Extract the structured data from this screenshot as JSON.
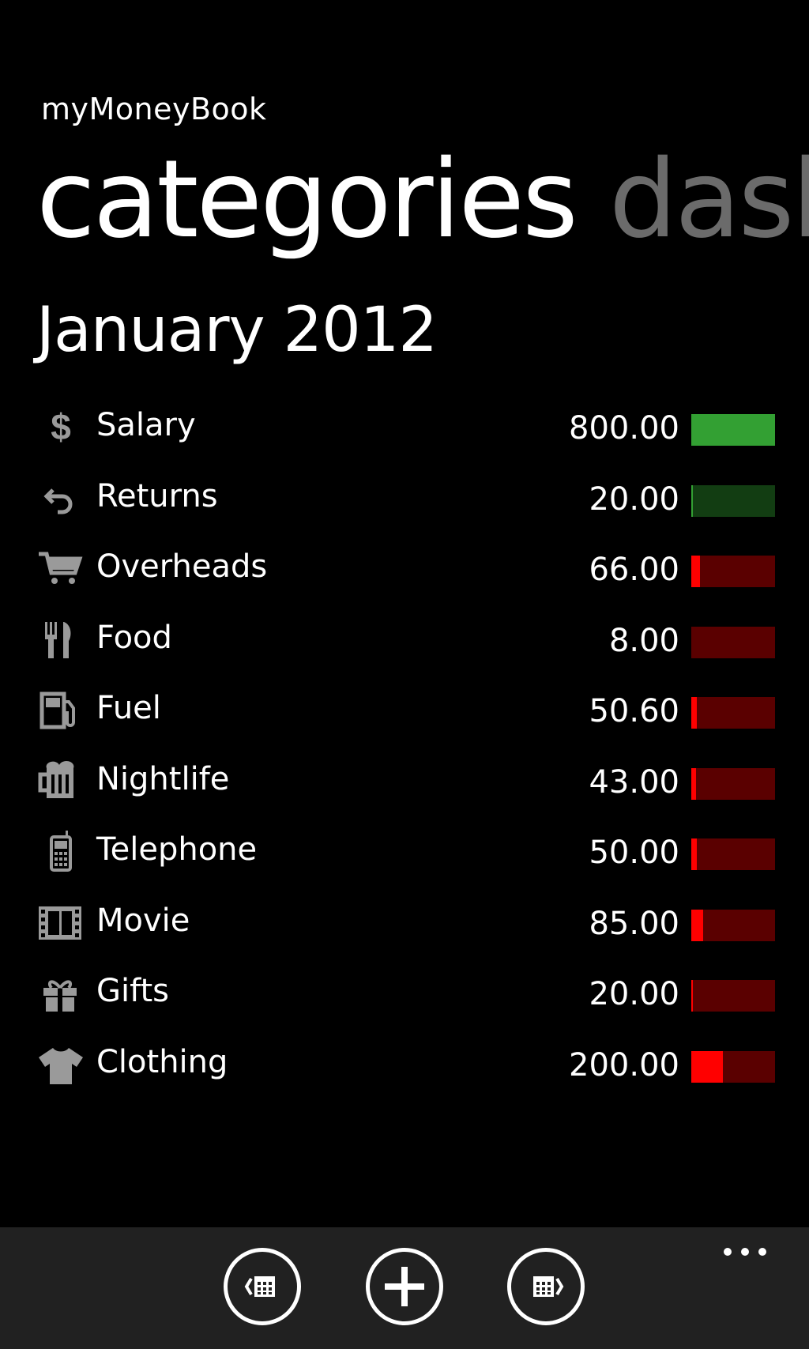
{
  "app": {
    "title": "myMoneyBook"
  },
  "pivot": {
    "items": [
      "categories",
      "dashboard"
    ]
  },
  "period": "January 2012",
  "categories": [
    {
      "name": "Salary",
      "amount": "800.00",
      "icon": "dollar-icon",
      "type": "income",
      "fill": 1.0
    },
    {
      "name": "Returns",
      "amount": "20.00",
      "icon": "return-arrow-icon",
      "type": "income",
      "fill": 0.02
    },
    {
      "name": "Overheads",
      "amount": "66.00",
      "icon": "shopping-cart-icon",
      "type": "expense",
      "fill": 0.1
    },
    {
      "name": "Food",
      "amount": "8.00",
      "icon": "fork-knife-icon",
      "type": "expense",
      "fill": 0.0
    },
    {
      "name": "Fuel",
      "amount": "50.60",
      "icon": "fuel-pump-icon",
      "type": "expense",
      "fill": 0.07
    },
    {
      "name": "Nightlife",
      "amount": "43.00",
      "icon": "beer-mug-icon",
      "type": "expense",
      "fill": 0.06
    },
    {
      "name": "Telephone",
      "amount": "50.00",
      "icon": "mobile-phone-icon",
      "type": "expense",
      "fill": 0.07
    },
    {
      "name": "Movie",
      "amount": "85.00",
      "icon": "film-strip-icon",
      "type": "expense",
      "fill": 0.14
    },
    {
      "name": "Gifts",
      "amount": "20.00",
      "icon": "gift-icon",
      "type": "expense",
      "fill": 0.02
    },
    {
      "name": "Clothing",
      "amount": "200.00",
      "icon": "tshirt-icon",
      "type": "expense",
      "fill": 0.38
    }
  ],
  "colors": {
    "income_fill": "#33a033",
    "income_track": "#123d12",
    "expense_fill": "#ff0000",
    "expense_track": "#5a0000",
    "icon": "#9a9a9a",
    "appbar": "#212121",
    "inactive_pivot": "#6b6b6b"
  },
  "appbar": {
    "buttons": [
      "previous-month-icon",
      "add-icon",
      "next-month-icon"
    ],
    "more": "more-icon"
  }
}
